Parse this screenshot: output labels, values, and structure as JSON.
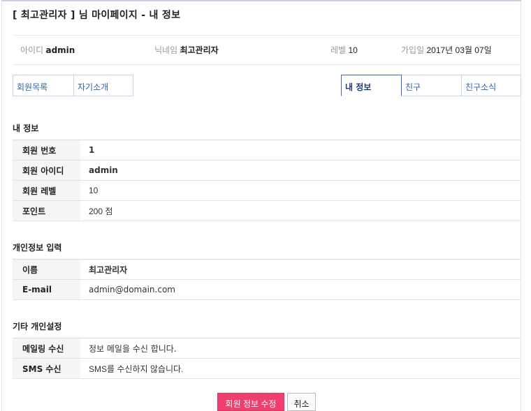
{
  "page": {
    "title": "[ 최고관리자 ] 님 마이페이지 - 내 정보"
  },
  "summary": {
    "id_label": "아이디",
    "id_value": "admin",
    "nick_label": "닉네임",
    "nick_value": "최고관리자",
    "level_label": "레벨",
    "level_value": "10",
    "joined_label": "가입일",
    "joined_value": "2017년 03월 07일"
  },
  "tabs_left": [
    {
      "label": "회원목록"
    },
    {
      "label": "자기소개"
    }
  ],
  "tabs_right": [
    {
      "label": "내 정보",
      "active": true
    },
    {
      "label": "친구"
    },
    {
      "label": "친구소식"
    }
  ],
  "my_info": {
    "heading": "내 정보",
    "rows": [
      {
        "label": "회원 번호",
        "value": "1"
      },
      {
        "label": "회원 아이디",
        "value": "admin"
      },
      {
        "label": "회원 레벨",
        "value": "10"
      },
      {
        "label": "포인트",
        "value": "200 점"
      }
    ]
  },
  "personal": {
    "heading": "개인정보 입력",
    "rows": [
      {
        "label": "이름",
        "value": "최고관리자"
      },
      {
        "label": "E-mail",
        "value": "admin@domain.com"
      }
    ]
  },
  "settings": {
    "heading": "기타 개인설정",
    "rows": [
      {
        "label": "메일링 수신",
        "value": "정보 메일을 수신 합니다."
      },
      {
        "label": "SMS 수신",
        "value": "SMS를 수신하지 않습니다."
      }
    ]
  },
  "buttons": {
    "edit": "회원 정보 수정",
    "cancel": "취소"
  },
  "colors": {
    "primary_button": "#ee3f6f",
    "tab_text": "#2f5fb3",
    "tab_border": "#c8d4ea"
  }
}
